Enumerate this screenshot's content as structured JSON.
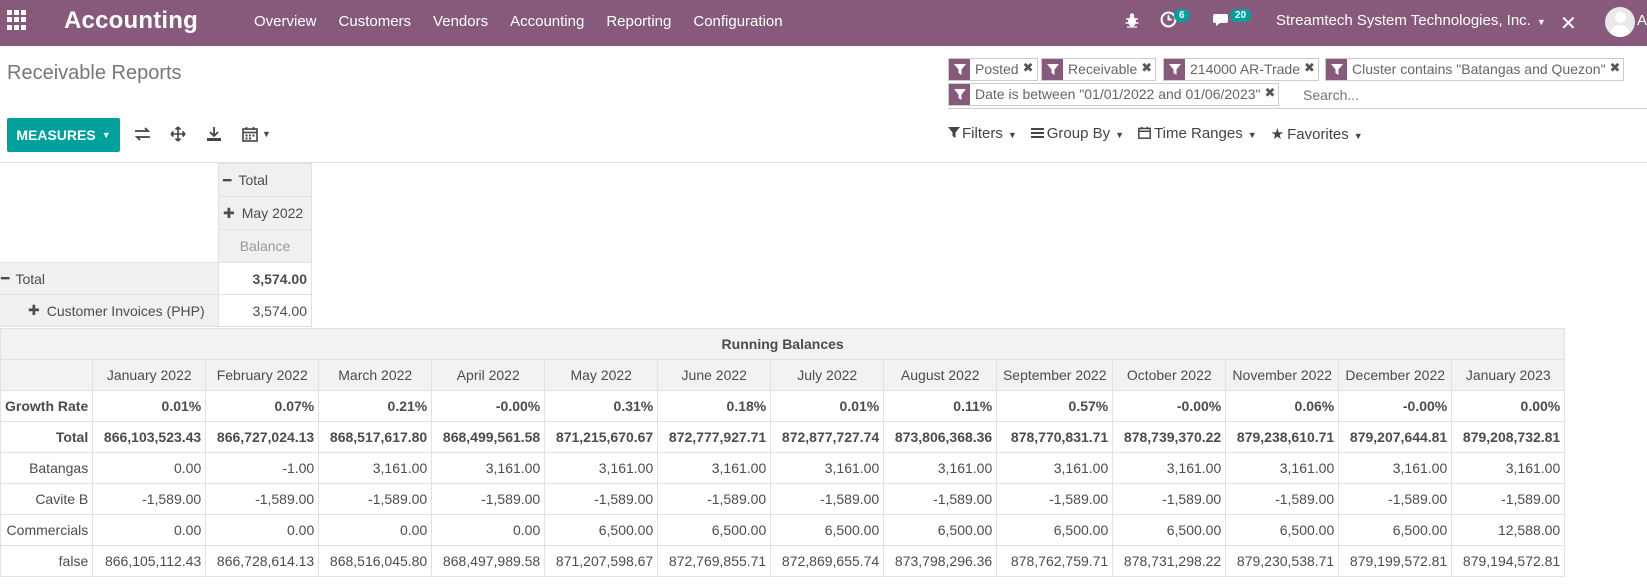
{
  "navbar": {
    "app_title": "Accounting",
    "menu": [
      "Overview",
      "Customers",
      "Vendors",
      "Accounting",
      "Reporting",
      "Configuration"
    ],
    "activity_count": "6",
    "message_count": "20",
    "company": "Streamtech System Technologies, Inc.",
    "user_initial": "A"
  },
  "page": {
    "breadcrumb": "Receivable Reports"
  },
  "search": {
    "facets": [
      "Posted",
      "Receivable",
      "214000 AR-Trade",
      "Cluster contains \"Batangas and Quezon\"",
      "Date is between \"01/01/2022 and 01/06/2023\""
    ],
    "placeholder": "Search...",
    "filters_label": "Filters",
    "groupby_label": "Group By",
    "timeranges_label": "Time Ranges",
    "favorites_label": "Favorites"
  },
  "toolbar": {
    "measures_label": "MEASURES"
  },
  "pivot": {
    "col_total": "Total",
    "col_group": "May 2022",
    "measure": "Balance",
    "row_total_label": "Total",
    "row_total_value": "3,574.00",
    "row_group_label": "Customer Invoices (PHP)",
    "row_group_value": "3,574.00"
  },
  "running_balances": {
    "title": "Running Balances",
    "months": [
      "January 2022",
      "February 2022",
      "March 2022",
      "April 2022",
      "May 2022",
      "June 2022",
      "July 2022",
      "August 2022",
      "September 2022",
      "October 2022",
      "November 2022",
      "December 2022",
      "January 2023"
    ],
    "rows": [
      {
        "label": "Growth Rate",
        "bold": true,
        "values": [
          "0.01%",
          "0.07%",
          "0.21%",
          "-0.00%",
          "0.31%",
          "0.18%",
          "0.01%",
          "0.11%",
          "0.57%",
          "-0.00%",
          "0.06%",
          "-0.00%",
          "0.00%"
        ]
      },
      {
        "label": "Total",
        "bold": true,
        "values": [
          "866,103,523.43",
          "866,727,024.13",
          "868,517,617.80",
          "868,499,561.58",
          "871,215,670.67",
          "872,777,927.71",
          "872,877,727.74",
          "873,806,368.36",
          "878,770,831.71",
          "878,739,370.22",
          "879,238,610.71",
          "879,207,644.81",
          "879,208,732.81"
        ]
      },
      {
        "label": "Batangas",
        "bold": false,
        "values": [
          "0.00",
          "-1.00",
          "3,161.00",
          "3,161.00",
          "3,161.00",
          "3,161.00",
          "3,161.00",
          "3,161.00",
          "3,161.00",
          "3,161.00",
          "3,161.00",
          "3,161.00",
          "3,161.00"
        ]
      },
      {
        "label": "Cavite B",
        "bold": false,
        "values": [
          "-1,589.00",
          "-1,589.00",
          "-1,589.00",
          "-1,589.00",
          "-1,589.00",
          "-1,589.00",
          "-1,589.00",
          "-1,589.00",
          "-1,589.00",
          "-1,589.00",
          "-1,589.00",
          "-1,589.00",
          "-1,589.00"
        ]
      },
      {
        "label": "Commercials",
        "bold": false,
        "values": [
          "0.00",
          "0.00",
          "0.00",
          "0.00",
          "6,500.00",
          "6,500.00",
          "6,500.00",
          "6,500.00",
          "6,500.00",
          "6,500.00",
          "6,500.00",
          "6,500.00",
          "12,588.00"
        ]
      },
      {
        "label": "false",
        "bold": false,
        "values": [
          "866,105,112.43",
          "866,728,614.13",
          "868,516,045.80",
          "868,497,989.58",
          "871,207,598.67",
          "872,769,855.71",
          "872,869,655.74",
          "873,798,296.36",
          "878,762,759.71",
          "878,731,298.22",
          "879,230,538.71",
          "879,199,572.81",
          "879,194,572.81"
        ]
      }
    ]
  }
}
